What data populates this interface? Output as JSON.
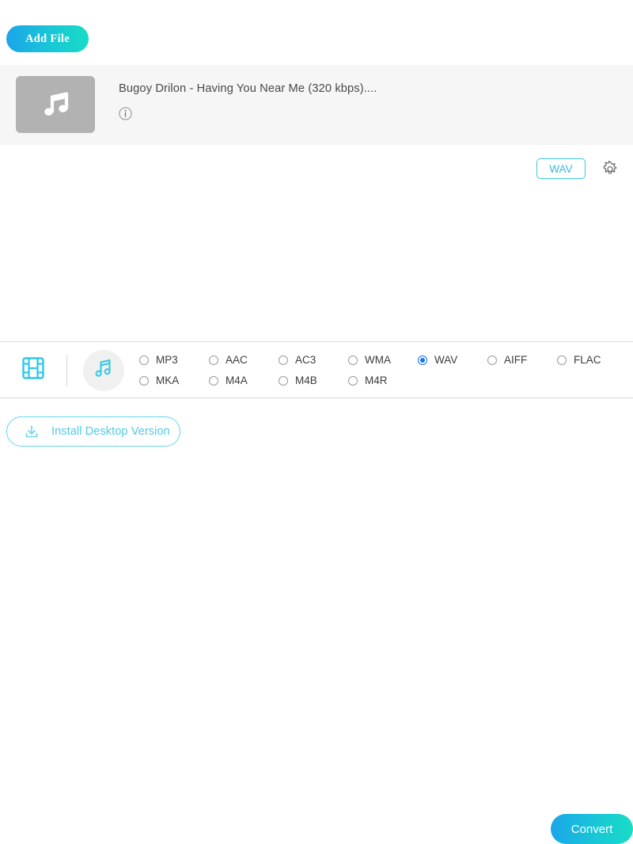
{
  "toolbar": {
    "add_file_label": "Add File"
  },
  "file_list": {
    "rows": [
      {
        "title": "Bugoy Drilon - Having You Near Me (320 kbps)....",
        "thumb_icon": "music-note-icon",
        "info_icon": "info-circle-icon",
        "output_format": "WAV",
        "settings_icon": "gear-icon"
      }
    ]
  },
  "format_bar": {
    "tabs": [
      {
        "name": "video",
        "icon": "film-strip-icon",
        "active": false
      },
      {
        "name": "audio",
        "icon": "music-note-icon",
        "active": true
      }
    ],
    "formats": [
      {
        "label": "MP3",
        "selected": false
      },
      {
        "label": "AAC",
        "selected": false
      },
      {
        "label": "AC3",
        "selected": false
      },
      {
        "label": "WMA",
        "selected": false
      },
      {
        "label": "WAV",
        "selected": true
      },
      {
        "label": "AIFF",
        "selected": false
      },
      {
        "label": "FLAC",
        "selected": false
      },
      {
        "label": "MKA",
        "selected": false
      },
      {
        "label": "M4A",
        "selected": false
      },
      {
        "label": "M4B",
        "selected": false
      },
      {
        "label": "M4R",
        "selected": false
      }
    ]
  },
  "footer": {
    "install_label": "Install Desktop Version",
    "install_icon": "download-icon",
    "convert_label": "Convert"
  },
  "colors": {
    "accent_start": "#1ba6ea",
    "accent_end": "#17dcc6",
    "badge_outline": "#3fc7e4",
    "badge_text": "#35b9dd",
    "radio_selected": "#1473e6",
    "row_background": "#f6f6f6",
    "thumb_background": "#b2b2b2"
  }
}
